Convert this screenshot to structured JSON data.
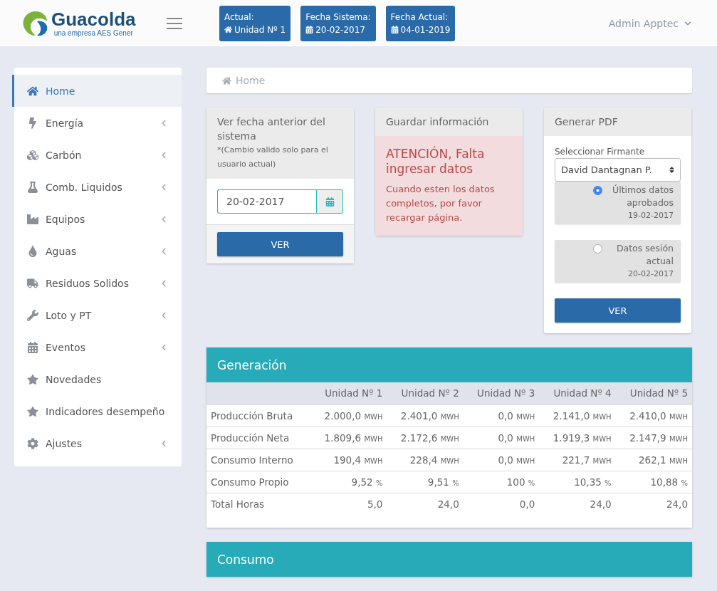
{
  "header": {
    "logo": {
      "name": "Guacolda",
      "tagline": "una empresa AES Gener"
    },
    "badges": [
      {
        "label": "Actual:",
        "value": "Unidad Nº 1",
        "kind": "home"
      },
      {
        "label": "Fecha Sistema:",
        "value": "20-02-2017",
        "kind": "calendar"
      },
      {
        "label": "Fecha Actual:",
        "value": "04-01-2019",
        "kind": "calendar"
      }
    ],
    "user": "Admin Apptec"
  },
  "sidebar": {
    "items": [
      {
        "label": "Home",
        "selected": true,
        "has_submenu": false
      },
      {
        "label": "Energía",
        "selected": false,
        "has_submenu": true
      },
      {
        "label": "Carbón",
        "selected": false,
        "has_submenu": true
      },
      {
        "label": "Comb. Liquidos",
        "selected": false,
        "has_submenu": true
      },
      {
        "label": "Equipos",
        "selected": false,
        "has_submenu": true
      },
      {
        "label": "Aguas",
        "selected": false,
        "has_submenu": true
      },
      {
        "label": "Residuos Solidos",
        "selected": false,
        "has_submenu": true
      },
      {
        "label": "Loto y PT",
        "selected": false,
        "has_submenu": true
      },
      {
        "label": "Eventos",
        "selected": false,
        "has_submenu": true
      },
      {
        "label": "Novedades",
        "selected": false,
        "has_submenu": false
      },
      {
        "label": "Indicadores desempeño",
        "selected": false,
        "has_submenu": false
      },
      {
        "label": "Ajustes",
        "selected": false,
        "has_submenu": true
      }
    ]
  },
  "breadcrumb": "Home",
  "date_card": {
    "title": "Ver fecha anterior del sistema",
    "note": "*(Cambio valido solo para el usuario actual)",
    "date_value": "20-02-2017",
    "button": "VER"
  },
  "save_card": {
    "title": "Guardar información",
    "alert_strong": "ATENCIÓN,",
    "alert_title": "Falta ingresar datos",
    "alert_text": "Cuando esten los datos completos, por favor recargar página."
  },
  "pdf_card": {
    "title": "Generar PDF",
    "select_label": "Seleccionar Firmante",
    "select_value": "David Dantagnan P.",
    "options": [
      {
        "label": "Últimos datos aprobados",
        "date": "19-02-2017",
        "selected": true
      },
      {
        "label": "Datos sesión actual",
        "date": "20-02-2017",
        "selected": false
      }
    ],
    "button": "VER"
  },
  "generation": {
    "title": "Generación",
    "columns": [
      "Unidad Nº 1",
      "Unidad Nº 2",
      "Unidad Nº 3",
      "Unidad Nº 4",
      "Unidad Nº 5"
    ],
    "rows": [
      {
        "label": "Producción Bruta",
        "cells": [
          {
            "value": "2.000,0",
            "unit": "MWH"
          },
          {
            "value": "2.401,0",
            "unit": "MWH"
          },
          {
            "value": "0,0",
            "unit": "MWH"
          },
          {
            "value": "2.141,0",
            "unit": "MWH"
          },
          {
            "value": "2.410,0",
            "unit": "MWH"
          }
        ]
      },
      {
        "label": "Producción Neta",
        "cells": [
          {
            "value": "1.809,6",
            "unit": "MWH"
          },
          {
            "value": "2.172,6",
            "unit": "MWH"
          },
          {
            "value": "0,0",
            "unit": "MWH"
          },
          {
            "value": "1.919,3",
            "unit": "MWH"
          },
          {
            "value": "2.147,9",
            "unit": "MWH"
          }
        ]
      },
      {
        "label": "Consumo Interno",
        "cells": [
          {
            "value": "190,4",
            "unit": "MWH"
          },
          {
            "value": "228,4",
            "unit": "MWH"
          },
          {
            "value": "0,0",
            "unit": "MWH"
          },
          {
            "value": "221,7",
            "unit": "MWH"
          },
          {
            "value": "262,1",
            "unit": "MWH"
          }
        ]
      },
      {
        "label": "Consumo Propio",
        "cells": [
          {
            "value": "9,52",
            "unit": "%"
          },
          {
            "value": "9,51",
            "unit": "%"
          },
          {
            "value": "100",
            "unit": "%"
          },
          {
            "value": "10,35",
            "unit": "%"
          },
          {
            "value": "10,88",
            "unit": "%"
          }
        ]
      },
      {
        "label": "Total Horas",
        "cells": [
          {
            "value": "5,0"
          },
          {
            "value": "24,0"
          },
          {
            "value": "0,0"
          },
          {
            "value": "24,0"
          },
          {
            "value": "24,0"
          }
        ]
      }
    ]
  },
  "consumption": {
    "title": "Consumo"
  }
}
